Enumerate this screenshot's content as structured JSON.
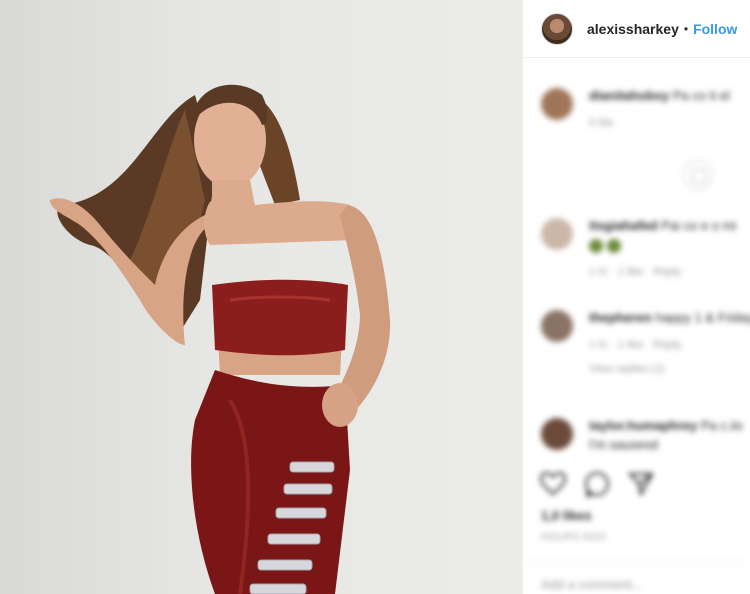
{
  "header": {
    "username": "alexissharkey",
    "separator": "•",
    "follow_label": "Follow"
  },
  "comments": [
    {
      "user": "dianitahobsy",
      "text": "Pa co ti el",
      "meta": "9 Me"
    },
    {
      "user": "itsgiahafed",
      "text": "Pai co e o mi",
      "meta": "1 hr  ·  1 like  ·  Reply"
    },
    {
      "user": "thepheren",
      "text": "happy 1 & Friday",
      "meta": "1 hr  ·  1 like  ·  Reply",
      "replies": "View replies (1)"
    },
    {
      "user": "taylor.humaphrey",
      "text": "Pa c.iis",
      "subtext": "I'm sausesd"
    }
  ],
  "post": {
    "likes": "1,0 likes",
    "date": "HOURS AGO",
    "add_comment_placeholder": "Add a comment..."
  },
  "icons": {
    "heart": "heart-icon",
    "comment": "comment-icon",
    "share": "share-icon",
    "load_more": "plus-circle-icon"
  },
  "colors": {
    "follow": "#3897f0",
    "outfit": "#8c1d1d",
    "wall": "#e4e4e2"
  }
}
